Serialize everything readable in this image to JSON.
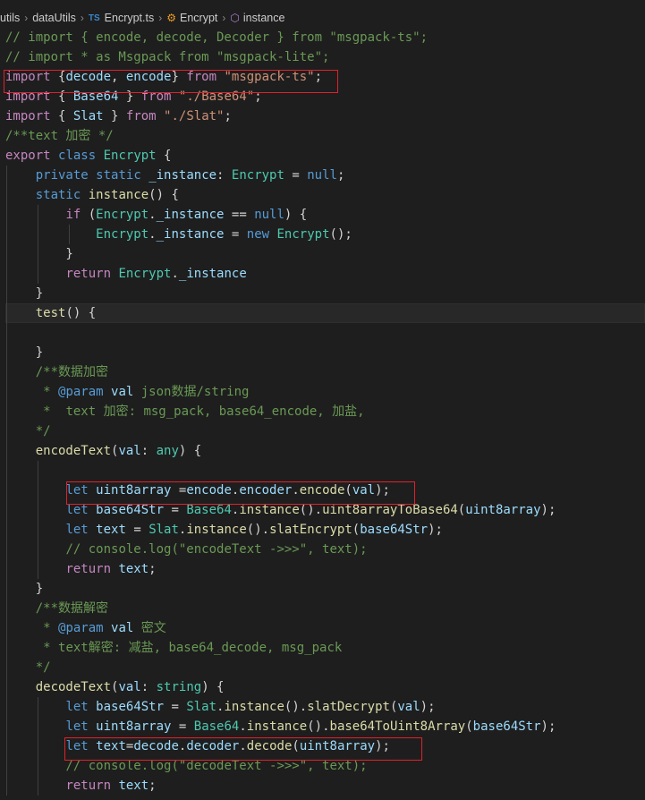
{
  "breadcrumb": {
    "folder1": "utils",
    "folder2": "dataUtils",
    "file_badge": "TS",
    "file": "Encrypt.ts",
    "class_name": "Encrypt",
    "method_name": "instance"
  },
  "code_lines": [
    [
      [
        "cmt",
        "// import { encode, decode, Decoder } from \"msgpack-ts\";"
      ]
    ],
    [
      [
        "cmt",
        "// import * as Msgpack from \"msgpack-lite\";"
      ]
    ],
    [
      [
        "ctl",
        "import"
      ],
      [
        "def",
        " {"
      ],
      [
        "var",
        "decode"
      ],
      [
        "def",
        ", "
      ],
      [
        "var",
        "encode"
      ],
      [
        "def",
        "} "
      ],
      [
        "ctl",
        "from"
      ],
      [
        "def",
        " "
      ],
      [
        "str",
        "\"msgpack-ts\""
      ],
      [
        "def",
        ";"
      ]
    ],
    [
      [
        "ctl",
        "import"
      ],
      [
        "def",
        " { "
      ],
      [
        "var",
        "Base64"
      ],
      [
        "def",
        " } "
      ],
      [
        "ctl",
        "from"
      ],
      [
        "def",
        " "
      ],
      [
        "str",
        "\"./Base64\""
      ],
      [
        "def",
        ";"
      ]
    ],
    [
      [
        "ctl",
        "import"
      ],
      [
        "def",
        " { "
      ],
      [
        "var",
        "Slat"
      ],
      [
        "def",
        " } "
      ],
      [
        "ctl",
        "from"
      ],
      [
        "def",
        " "
      ],
      [
        "str",
        "\"./Slat\""
      ],
      [
        "def",
        ";"
      ]
    ],
    [
      [
        "cmt",
        "/**text 加密 */"
      ]
    ],
    [
      [
        "ctl",
        "export"
      ],
      [
        "def",
        " "
      ],
      [
        "kw",
        "class"
      ],
      [
        "def",
        " "
      ],
      [
        "typ",
        "Encrypt"
      ],
      [
        "def",
        " {"
      ]
    ],
    [
      [
        "def",
        "    "
      ],
      [
        "kw",
        "private"
      ],
      [
        "def",
        " "
      ],
      [
        "kw",
        "static"
      ],
      [
        "def",
        " "
      ],
      [
        "var",
        "_instance"
      ],
      [
        "def",
        ": "
      ],
      [
        "typ",
        "Encrypt"
      ],
      [
        "def",
        " = "
      ],
      [
        "kw",
        "null"
      ],
      [
        "def",
        ";"
      ]
    ],
    [
      [
        "def",
        "    "
      ],
      [
        "kw",
        "static"
      ],
      [
        "def",
        " "
      ],
      [
        "fn",
        "instance"
      ],
      [
        "def",
        "() {"
      ]
    ],
    [
      [
        "def",
        "        "
      ],
      [
        "ctl",
        "if"
      ],
      [
        "def",
        " ("
      ],
      [
        "typ",
        "Encrypt"
      ],
      [
        "def",
        "."
      ],
      [
        "var",
        "_instance"
      ],
      [
        "def",
        " == "
      ],
      [
        "kw",
        "null"
      ],
      [
        "def",
        ") {"
      ]
    ],
    [
      [
        "def",
        "            "
      ],
      [
        "typ",
        "Encrypt"
      ],
      [
        "def",
        "."
      ],
      [
        "var",
        "_instance"
      ],
      [
        "def",
        " = "
      ],
      [
        "kw",
        "new"
      ],
      [
        "def",
        " "
      ],
      [
        "typ",
        "Encrypt"
      ],
      [
        "def",
        "();"
      ]
    ],
    [
      [
        "def",
        "        }"
      ]
    ],
    [
      [
        "def",
        "        "
      ],
      [
        "ctl",
        "return"
      ],
      [
        "def",
        " "
      ],
      [
        "typ",
        "Encrypt"
      ],
      [
        "def",
        "."
      ],
      [
        "var",
        "_instance"
      ]
    ],
    [
      [
        "def",
        "    }"
      ]
    ],
    [
      [
        "def",
        "    "
      ],
      [
        "fn",
        "test"
      ],
      [
        "def",
        "() {"
      ]
    ],
    [],
    [
      [
        "def",
        "    }"
      ]
    ],
    [
      [
        "def",
        "    "
      ],
      [
        "cmt",
        "/**数据加密"
      ]
    ],
    [
      [
        "def",
        "     "
      ],
      [
        "cmt",
        "* "
      ],
      [
        "doc",
        "@param"
      ],
      [
        "cmt",
        " "
      ],
      [
        "var",
        "val"
      ],
      [
        "cmt",
        " json数据/string"
      ]
    ],
    [
      [
        "def",
        "     "
      ],
      [
        "cmt",
        "*  text 加密: msg_pack, base64_encode, 加盐,"
      ]
    ],
    [
      [
        "def",
        "    "
      ],
      [
        "cmt",
        "*/"
      ]
    ],
    [
      [
        "def",
        "    "
      ],
      [
        "fn",
        "encodeText"
      ],
      [
        "def",
        "("
      ],
      [
        "var",
        "val"
      ],
      [
        "def",
        ": "
      ],
      [
        "typ",
        "any"
      ],
      [
        "def",
        ") {"
      ]
    ],
    [],
    [
      [
        "def",
        "        "
      ],
      [
        "kw",
        "let"
      ],
      [
        "def",
        " "
      ],
      [
        "var",
        "uint8array"
      ],
      [
        "def",
        " ="
      ],
      [
        "var",
        "encode"
      ],
      [
        "def",
        "."
      ],
      [
        "var",
        "encoder"
      ],
      [
        "def",
        "."
      ],
      [
        "fn",
        "encode"
      ],
      [
        "def",
        "("
      ],
      [
        "var",
        "val"
      ],
      [
        "def",
        ");"
      ]
    ],
    [
      [
        "def",
        "        "
      ],
      [
        "kw",
        "let"
      ],
      [
        "def",
        " "
      ],
      [
        "var",
        "base64Str"
      ],
      [
        "def",
        " = "
      ],
      [
        "typ",
        "Base64"
      ],
      [
        "def",
        "."
      ],
      [
        "fn",
        "instance"
      ],
      [
        "def",
        "()."
      ],
      [
        "fn",
        "uint8arrayToBase64"
      ],
      [
        "def",
        "("
      ],
      [
        "var",
        "uint8array"
      ],
      [
        "def",
        ");"
      ]
    ],
    [
      [
        "def",
        "        "
      ],
      [
        "kw",
        "let"
      ],
      [
        "def",
        " "
      ],
      [
        "var",
        "text"
      ],
      [
        "def",
        " = "
      ],
      [
        "typ",
        "Slat"
      ],
      [
        "def",
        "."
      ],
      [
        "fn",
        "instance"
      ],
      [
        "def",
        "()."
      ],
      [
        "fn",
        "slatEncrypt"
      ],
      [
        "def",
        "("
      ],
      [
        "var",
        "base64Str"
      ],
      [
        "def",
        ");"
      ]
    ],
    [
      [
        "def",
        "        "
      ],
      [
        "cmt",
        "// console.log(\"encodeText ->>>\", text);"
      ]
    ],
    [
      [
        "def",
        "        "
      ],
      [
        "ctl",
        "return"
      ],
      [
        "def",
        " "
      ],
      [
        "var",
        "text"
      ],
      [
        "def",
        ";"
      ]
    ],
    [
      [
        "def",
        "    }"
      ]
    ],
    [
      [
        "def",
        "    "
      ],
      [
        "cmt",
        "/**数据解密"
      ]
    ],
    [
      [
        "def",
        "     "
      ],
      [
        "cmt",
        "* "
      ],
      [
        "doc",
        "@param"
      ],
      [
        "cmt",
        " "
      ],
      [
        "var",
        "val"
      ],
      [
        "cmt",
        " 密文"
      ]
    ],
    [
      [
        "def",
        "     "
      ],
      [
        "cmt",
        "* text解密: 减盐, base64_decode, msg_pack"
      ]
    ],
    [
      [
        "def",
        "    "
      ],
      [
        "cmt",
        "*/"
      ]
    ],
    [
      [
        "def",
        "    "
      ],
      [
        "fn",
        "decodeText"
      ],
      [
        "def",
        "("
      ],
      [
        "var",
        "val"
      ],
      [
        "def",
        ": "
      ],
      [
        "typ",
        "string"
      ],
      [
        "def",
        ") {"
      ]
    ],
    [
      [
        "def",
        "        "
      ],
      [
        "kw",
        "let"
      ],
      [
        "def",
        " "
      ],
      [
        "var",
        "base64Str"
      ],
      [
        "def",
        " = "
      ],
      [
        "typ",
        "Slat"
      ],
      [
        "def",
        "."
      ],
      [
        "fn",
        "instance"
      ],
      [
        "def",
        "()."
      ],
      [
        "fn",
        "slatDecrypt"
      ],
      [
        "def",
        "("
      ],
      [
        "var",
        "val"
      ],
      [
        "def",
        ");"
      ]
    ],
    [
      [
        "def",
        "        "
      ],
      [
        "kw",
        "let"
      ],
      [
        "def",
        " "
      ],
      [
        "var",
        "uint8array"
      ],
      [
        "def",
        " = "
      ],
      [
        "typ",
        "Base64"
      ],
      [
        "def",
        "."
      ],
      [
        "fn",
        "instance"
      ],
      [
        "def",
        "()."
      ],
      [
        "fn",
        "base64ToUint8Array"
      ],
      [
        "def",
        "("
      ],
      [
        "var",
        "base64Str"
      ],
      [
        "def",
        ");"
      ]
    ],
    [
      [
        "def",
        "        "
      ],
      [
        "kw",
        "let"
      ],
      [
        "def",
        " "
      ],
      [
        "var",
        "text"
      ],
      [
        "def",
        "="
      ],
      [
        "var",
        "decode"
      ],
      [
        "def",
        "."
      ],
      [
        "var",
        "decoder"
      ],
      [
        "def",
        "."
      ],
      [
        "fn",
        "decode"
      ],
      [
        "def",
        "("
      ],
      [
        "var",
        "uint8array"
      ],
      [
        "def",
        ");"
      ]
    ],
    [
      [
        "def",
        "        "
      ],
      [
        "cmt",
        "// console.log(\"decodeText ->>>\", text);"
      ]
    ],
    [
      [
        "def",
        "        "
      ],
      [
        "ctl",
        "return"
      ],
      [
        "def",
        " "
      ],
      [
        "var",
        "text"
      ],
      [
        "def",
        ";"
      ]
    ]
  ]
}
